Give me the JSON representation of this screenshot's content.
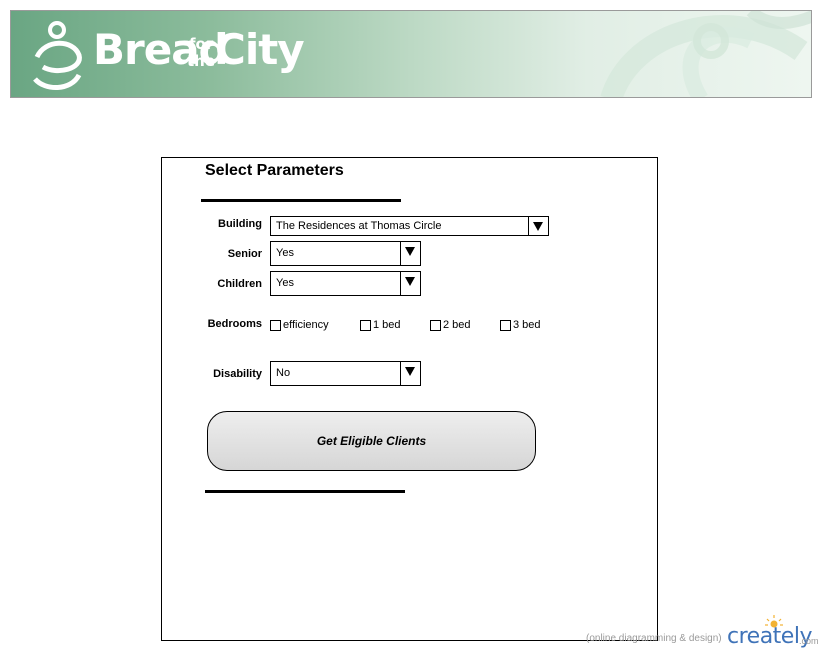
{
  "banner": {
    "brand_bread": "Bread",
    "brand_for": "for",
    "brand_the": "the",
    "brand_city": "City",
    "trademark": "™"
  },
  "form": {
    "title": "Select Parameters",
    "building": {
      "label": "Building",
      "value": "The Residences at Thomas Circle"
    },
    "senior": {
      "label": "Senior",
      "value": "Yes"
    },
    "children": {
      "label": "Children",
      "value": "Yes"
    },
    "bedrooms": {
      "label": "Bedrooms",
      "options": [
        {
          "label": "efficiency",
          "checked": false
        },
        {
          "label": "1 bed",
          "checked": false
        },
        {
          "label": "2 bed",
          "checked": false
        },
        {
          "label": "3 bed",
          "checked": false
        }
      ]
    },
    "disability": {
      "label": "Disability",
      "value": "No"
    },
    "submit_label": "Get Eligible Clients"
  },
  "watermark": {
    "text": "(online diagramming & design)",
    "logo": "creately",
    "suffix": ".com"
  }
}
